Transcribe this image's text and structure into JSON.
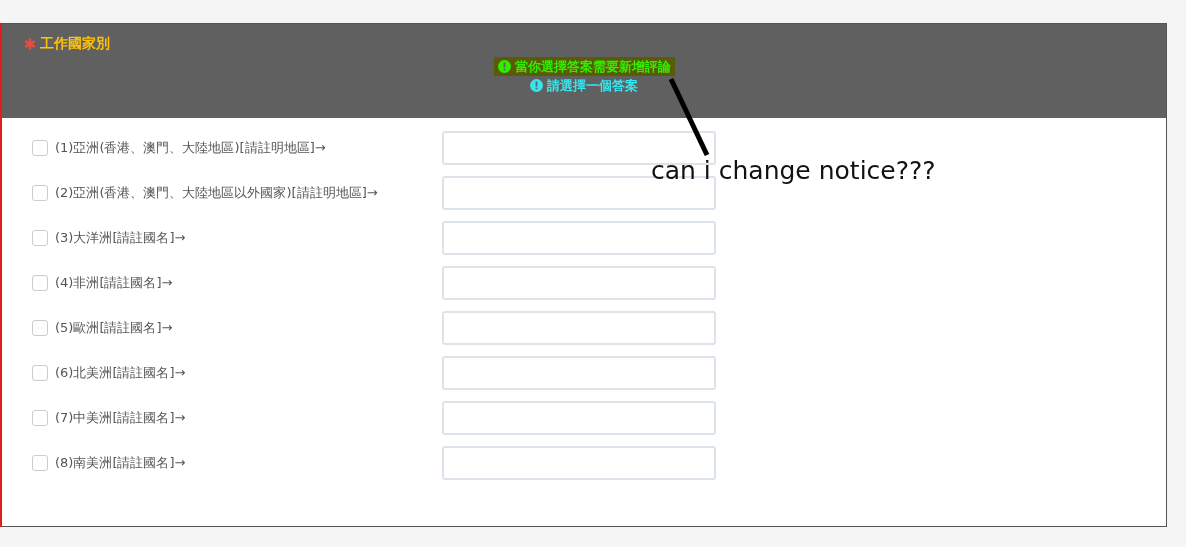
{
  "question": {
    "required": true,
    "title": "工作國家別"
  },
  "notices": [
    {
      "kind": "comment",
      "text": "當你選擇答案需要新增評論",
      "highlighted": true
    },
    {
      "kind": "info",
      "text": "請選擇一個答案",
      "highlighted": false
    }
  ],
  "options": [
    {
      "label": "(1)亞洲(香港、澳門、大陸地區)[請註明地區]→",
      "checked": false
    },
    {
      "label": "(2)亞洲(香港、澳門、大陸地區以外國家)[請註明地區]→",
      "checked": false
    },
    {
      "label": "(3)大洋洲[請註國名]→",
      "checked": false
    },
    {
      "label": "(4)非洲[請註國名]→",
      "checked": false
    },
    {
      "label": "(5)歐洲[請註國名]→",
      "checked": false
    },
    {
      "label": "(6)北美洲[請註國名]→",
      "checked": false
    },
    {
      "label": "(7)中美洲[請註國名]→",
      "checked": false
    },
    {
      "label": "(8)南美洲[請註國名]→",
      "checked": false
    }
  ],
  "annotation": {
    "text": "can i change notice???"
  }
}
